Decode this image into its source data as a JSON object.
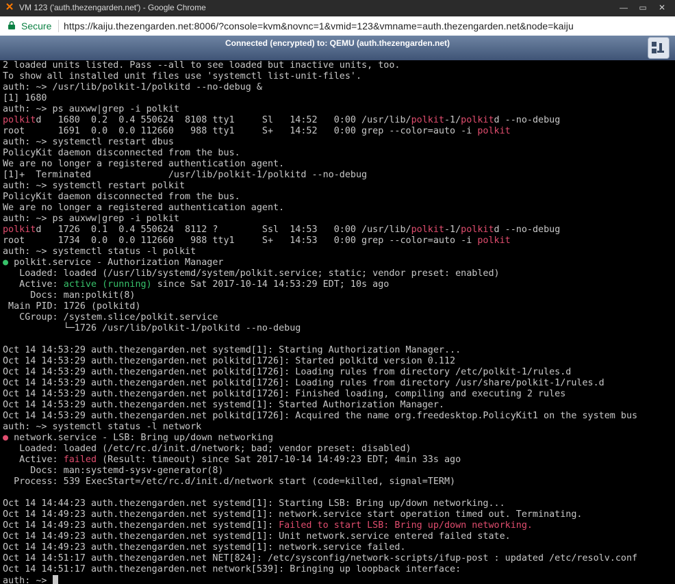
{
  "window": {
    "title": "VM 123 ('auth.thezengarden.net') - Google Chrome",
    "controls": [
      "—",
      "▭",
      "✕"
    ]
  },
  "browser": {
    "secure_label": "Secure",
    "url": "https://kaiju.thezengarden.net:8006/?console=kvm&novnc=1&vmid=123&vmname=auth.thezengarden.net&node=kaiju"
  },
  "novnc": {
    "status": "Connected (encrypted) to: QEMU (auth.thezengarden.net)"
  },
  "colors": {
    "highlight": "#e04d6e",
    "active": "#37c26a",
    "terminal_text": "#c8c8c8",
    "terminal_bg": "#000000",
    "novnc_bar": "#4e6386"
  },
  "terminal": {
    "lines": [
      [
        {
          "t": "2 loaded units listed. Pass --all to see loaded but inactive units, too."
        }
      ],
      [
        {
          "t": "To show all installed unit files use 'systemctl list-unit-files'."
        }
      ],
      [
        {
          "t": "auth: ~> /usr/lib/polkit-1/polkitd --no-debug &"
        }
      ],
      [
        {
          "t": "[1] 1680"
        }
      ],
      [
        {
          "t": "auth: ~> ps auxww|grep -i polkit"
        }
      ],
      [
        {
          "t": "polkit",
          "c": "hl"
        },
        {
          "t": "d   1680  0.2  0.4 550624  8108 tty1     Sl   14:52   0:00 /usr/lib/"
        },
        {
          "t": "polkit",
          "c": "hl"
        },
        {
          "t": "-1/"
        },
        {
          "t": "polkit",
          "c": "hl"
        },
        {
          "t": "d --no-debug"
        }
      ],
      [
        {
          "t": "root      1691  0.0  0.0 112660   988 tty1     S+   14:52   0:00 grep --color=auto -i "
        },
        {
          "t": "polkit",
          "c": "hl"
        }
      ],
      [
        {
          "t": "auth: ~> systemctl restart dbus"
        }
      ],
      [
        {
          "t": "PolicyKit daemon disconnected from the bus."
        }
      ],
      [
        {
          "t": "We are no longer a registered authentication agent."
        }
      ],
      [
        {
          "t": "[1]+  Terminated              /usr/lib/polkit-1/polkitd --no-debug"
        }
      ],
      [
        {
          "t": "auth: ~> systemctl restart polkit"
        }
      ],
      [
        {
          "t": "PolicyKit daemon disconnected from the bus."
        }
      ],
      [
        {
          "t": "We are no longer a registered authentication agent."
        }
      ],
      [
        {
          "t": "auth: ~> ps auxww|grep -i polkit"
        }
      ],
      [
        {
          "t": "polkit",
          "c": "hl"
        },
        {
          "t": "d   1726  0.1  0.4 550624  8112 ?        Ssl  14:53   0:00 /usr/lib/"
        },
        {
          "t": "polkit",
          "c": "hl"
        },
        {
          "t": "-1/"
        },
        {
          "t": "polkit",
          "c": "hl"
        },
        {
          "t": "d --no-debug"
        }
      ],
      [
        {
          "t": "root      1734  0.0  0.0 112660   988 tty1     S+   14:53   0:00 grep --color=auto -i "
        },
        {
          "t": "polkit",
          "c": "hl"
        }
      ],
      [
        {
          "t": "auth: ~> systemctl status -l polkit"
        }
      ],
      [
        {
          "t": "●",
          "c": "ok"
        },
        {
          "t": " polkit.service - Authorization Manager"
        }
      ],
      [
        {
          "t": "   Loaded: loaded (/usr/lib/systemd/system/polkit.service; static; vendor preset: enabled)"
        }
      ],
      [
        {
          "t": "   Active: "
        },
        {
          "t": "active (running)",
          "c": "ok"
        },
        {
          "t": " since Sat 2017-10-14 14:53:29 EDT; 10s ago"
        }
      ],
      [
        {
          "t": "     Docs: man:polkit(8)"
        }
      ],
      [
        {
          "t": " Main PID: 1726 (polkitd)"
        }
      ],
      [
        {
          "t": "   CGroup: /system.slice/polkit.service"
        }
      ],
      [
        {
          "t": "           └─1726 /usr/lib/polkit-1/polkitd --no-debug"
        }
      ],
      [
        {
          "t": ""
        }
      ],
      [
        {
          "t": "Oct 14 14:53:29 auth.thezengarden.net systemd[1]: Starting Authorization Manager..."
        }
      ],
      [
        {
          "t": "Oct 14 14:53:29 auth.thezengarden.net polkitd[1726]: Started polkitd version 0.112"
        }
      ],
      [
        {
          "t": "Oct 14 14:53:29 auth.thezengarden.net polkitd[1726]: Loading rules from directory /etc/polkit-1/rules.d"
        }
      ],
      [
        {
          "t": "Oct 14 14:53:29 auth.thezengarden.net polkitd[1726]: Loading rules from directory /usr/share/polkit-1/rules.d"
        }
      ],
      [
        {
          "t": "Oct 14 14:53:29 auth.thezengarden.net polkitd[1726]: Finished loading, compiling and executing 2 rules"
        }
      ],
      [
        {
          "t": "Oct 14 14:53:29 auth.thezengarden.net systemd[1]: Started Authorization Manager."
        }
      ],
      [
        {
          "t": "Oct 14 14:53:29 auth.thezengarden.net polkitd[1726]: Acquired the name org.freedesktop.PolicyKit1 on the system bus"
        }
      ],
      [
        {
          "t": "auth: ~> systemctl status -l network"
        }
      ],
      [
        {
          "t": "●",
          "c": "hl"
        },
        {
          "t": " network.service - LSB: Bring up/down networking"
        }
      ],
      [
        {
          "t": "   Loaded: loaded (/etc/rc.d/init.d/network; bad; vendor preset: disabled)"
        }
      ],
      [
        {
          "t": "   Active: "
        },
        {
          "t": "failed",
          "c": "hl"
        },
        {
          "t": " (Result: timeout) since Sat 2017-10-14 14:49:23 EDT; 4min 33s ago"
        }
      ],
      [
        {
          "t": "     Docs: man:systemd-sysv-generator(8)"
        }
      ],
      [
        {
          "t": "  Process: 539 ExecStart=/etc/rc.d/init.d/network start (code=killed, signal=TERM)"
        }
      ],
      [
        {
          "t": ""
        }
      ],
      [
        {
          "t": "Oct 14 14:44:23 auth.thezengarden.net systemd[1]: Starting LSB: Bring up/down networking..."
        }
      ],
      [
        {
          "t": "Oct 14 14:49:23 auth.thezengarden.net systemd[1]: network.service start operation timed out. Terminating."
        }
      ],
      [
        {
          "t": "Oct 14 14:49:23 auth.thezengarden.net systemd[1]: "
        },
        {
          "t": "Failed to start LSB: Bring up/down networking.",
          "c": "hl"
        }
      ],
      [
        {
          "t": "Oct 14 14:49:23 auth.thezengarden.net systemd[1]: Unit network.service entered failed state."
        }
      ],
      [
        {
          "t": "Oct 14 14:49:23 auth.thezengarden.net systemd[1]: network.service failed."
        }
      ],
      [
        {
          "t": "Oct 14 14:51:17 auth.thezengarden.net NET[824]: /etc/sysconfig/network-scripts/ifup-post : updated /etc/resolv.conf"
        }
      ],
      [
        {
          "t": "Oct 14 14:51:17 auth.thezengarden.net network[539]: Bringing up loopback interface:"
        }
      ],
      [
        {
          "t": "auth: ~> "
        }
      ]
    ]
  }
}
